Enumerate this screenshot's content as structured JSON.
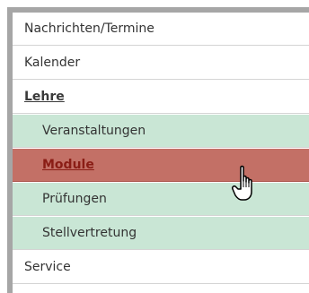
{
  "menu": {
    "items": [
      {
        "label": "Nachrichten/Termine",
        "level": 1
      },
      {
        "label": "Kalender",
        "level": 1
      },
      {
        "label": "Lehre",
        "level": 1,
        "expanded": true
      },
      {
        "label": "Veranstaltungen",
        "level": 2
      },
      {
        "label": "Module",
        "level": 2,
        "selected": true
      },
      {
        "label": "Prüfungen",
        "level": 2
      },
      {
        "label": "Stellvertretung",
        "level": 2
      },
      {
        "label": "Service",
        "level": 1
      }
    ]
  },
  "colors": {
    "frame": "#a6a6a6",
    "submenu_background": "#c9e6d5",
    "selected_background": "#c37066",
    "selected_text": "#8a1d15",
    "text": "#333333"
  },
  "cursor": {
    "icon": "hand-pointer-icon"
  }
}
